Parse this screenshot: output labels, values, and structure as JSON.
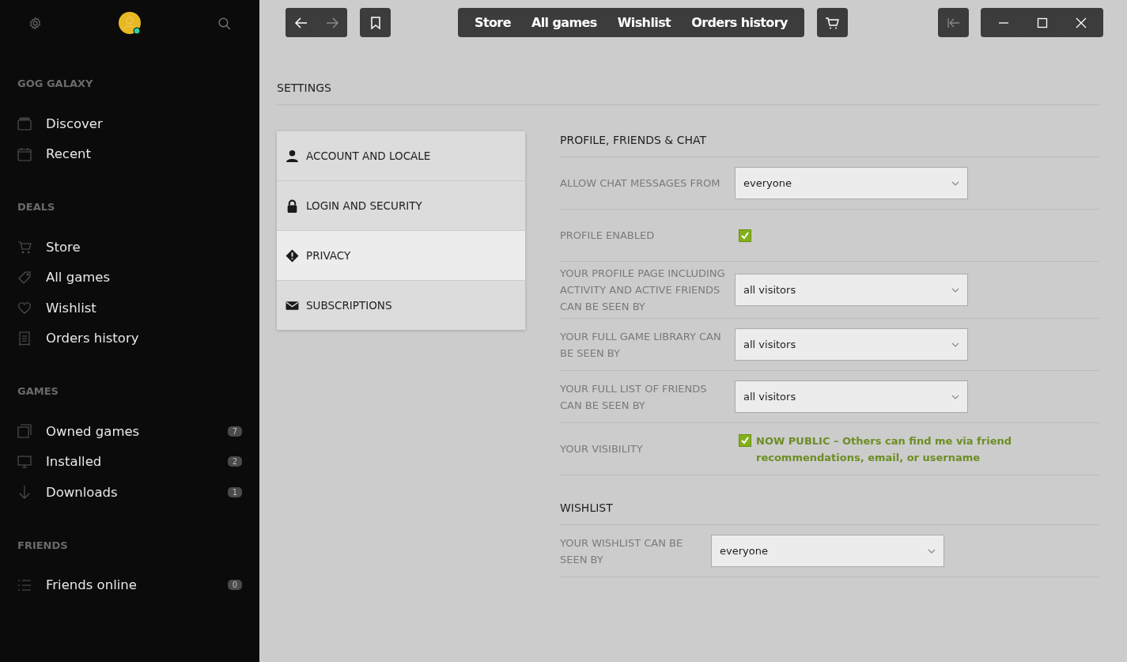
{
  "sidebar": {
    "sections": [
      {
        "title": "GOG GALAXY",
        "items": [
          {
            "label": "Discover"
          },
          {
            "label": "Recent"
          }
        ]
      },
      {
        "title": "DEALS",
        "items": [
          {
            "label": "Store"
          },
          {
            "label": "All games"
          },
          {
            "label": "Wishlist"
          },
          {
            "label": "Orders history"
          }
        ]
      },
      {
        "title": "GAMES",
        "items": [
          {
            "label": "Owned games",
            "count": "7"
          },
          {
            "label": "Installed",
            "count": "2"
          },
          {
            "label": "Downloads",
            "count": "1"
          }
        ]
      },
      {
        "title": "FRIENDS",
        "items": [
          {
            "label": "Friends online",
            "count": "0"
          }
        ]
      }
    ]
  },
  "nav_tabs": [
    {
      "label": "Store"
    },
    {
      "label": "All games"
    },
    {
      "label": "Wishlist"
    },
    {
      "label": "Orders history"
    }
  ],
  "page_title": "SETTINGS",
  "settings_menu": [
    {
      "label": "ACCOUNT AND LOCALE",
      "selected": false
    },
    {
      "label": "LOGIN AND SECURITY",
      "selected": false
    },
    {
      "label": "PRIVACY",
      "selected": true
    },
    {
      "label": "SUBSCRIPTIONS",
      "selected": false
    }
  ],
  "sections": [
    {
      "title": "PROFILE, FRIENDS & CHAT",
      "rows": [
        {
          "kind": "select",
          "label": "ALLOW CHAT MESSAGES FROM",
          "value": "everyone"
        },
        {
          "kind": "checkbox",
          "label": "PROFILE ENABLED",
          "checked": true
        },
        {
          "kind": "select",
          "label": "YOUR PROFILE PAGE INCLUDING ACTIVITY AND ACTIVE FRIENDS CAN BE SEEN BY",
          "value": "all visitors"
        },
        {
          "kind": "select",
          "label": "YOUR FULL GAME LIBRARY CAN BE SEEN BY",
          "value": "all visitors"
        },
        {
          "kind": "select",
          "label": "YOUR FULL LIST OF FRIENDS CAN BE SEEN BY",
          "value": "all visitors"
        },
        {
          "kind": "status",
          "label": "YOUR VISIBILITY",
          "checked": true,
          "status": "NOW PUBLIC – Others can find me via friend recommendations, email, or username"
        }
      ]
    },
    {
      "title": "WISHLIST",
      "rows": [
        {
          "kind": "select",
          "label": "YOUR WISHLIST CAN BE SEEN BY",
          "value": "everyone"
        }
      ]
    }
  ]
}
